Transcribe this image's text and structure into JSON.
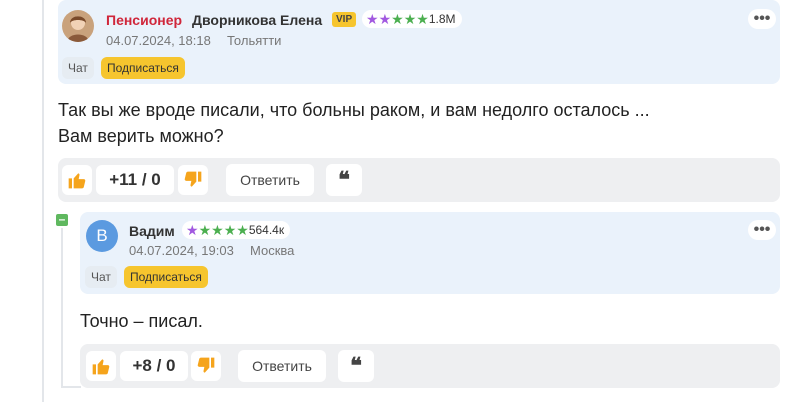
{
  "comment1": {
    "rank": "Пенсионер",
    "username": "Дворникова Елена",
    "vip": "VIP",
    "rating": "1.8M",
    "date": "04.07.2024, 18:18",
    "city": "Тольятти",
    "chat_label": "Чат",
    "subscribe_label": "Подписаться",
    "menu_label": "•••",
    "text_lines": [
      "Так вы же вроде писали, что больны раком, и вам недолго осталось ...",
      "Вам верить можно?"
    ],
    "score": "+11 / 0",
    "reply_label": "Ответить",
    "quote_label": "❝"
  },
  "comment2": {
    "avatar_letter": "В",
    "username": "Вадим",
    "rating": "564.4к",
    "date": "04.07.2024, 19:03",
    "city": "Москва",
    "chat_label": "Чат",
    "subscribe_label": "Подписаться",
    "menu_label": "•••",
    "text_lines": [
      "Точно – писал."
    ],
    "score": "+8 / 0",
    "reply_label": "Ответить",
    "quote_label": "❝",
    "collapse_label": "–"
  },
  "colors": {
    "header_bg": "#eaf2fb",
    "rank_red": "#d0263a",
    "star_purple": "#a259e0",
    "star_green": "#4caf50",
    "vip_yellow": "#f6c52e",
    "thumb_orange": "#f5a41c"
  },
  "icons": {
    "like": "thumbs-up-icon",
    "dislike": "thumbs-down-icon",
    "quote": "quote-icon",
    "menu": "more-icon",
    "collapse": "collapse-icon"
  }
}
